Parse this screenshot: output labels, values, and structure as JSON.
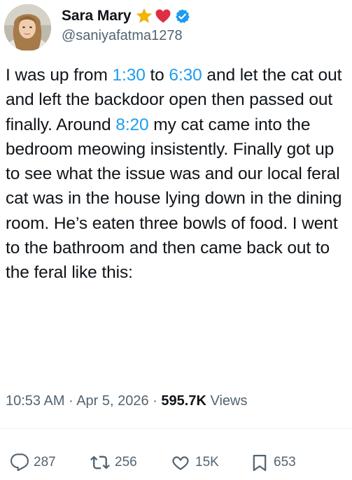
{
  "author": {
    "display_name": "Sara Mary",
    "handle": "@saniyafatma1278",
    "badges": [
      "star-emoji",
      "red-heart-emoji",
      "verified-badge-icon"
    ]
  },
  "tweet": {
    "segments": [
      {
        "text": "I was up from ",
        "link": false
      },
      {
        "text": "1:30",
        "link": true
      },
      {
        "text": " to ",
        "link": false
      },
      {
        "text": "6:30",
        "link": true
      },
      {
        "text": " and let the cat out and left the backdoor open then passed out finally. Around ",
        "link": false
      },
      {
        "text": "8:20",
        "link": true
      },
      {
        "text": " my cat came into the bedroom meowing insistently.  Finally got up to see what the issue was and our local feral cat was in the house lying down in the dining room.  He’s eaten three bowls of food. I went to the bathroom and then came back out to the feral like this:",
        "link": false
      }
    ],
    "time": "10:53 AM",
    "separator": "·",
    "date": "Apr 5, 2026",
    "views_count": "595.7K",
    "views_label": "Views"
  },
  "actions": {
    "replies": "287",
    "reposts": "256",
    "likes": "15K",
    "bookmarks": "653"
  },
  "colors": {
    "link": "#1d9bf0",
    "text": "#0f1419",
    "secondary": "#536471",
    "verified": "#1d9bf0",
    "heart": "#e0245e",
    "star": "#f5b400"
  }
}
